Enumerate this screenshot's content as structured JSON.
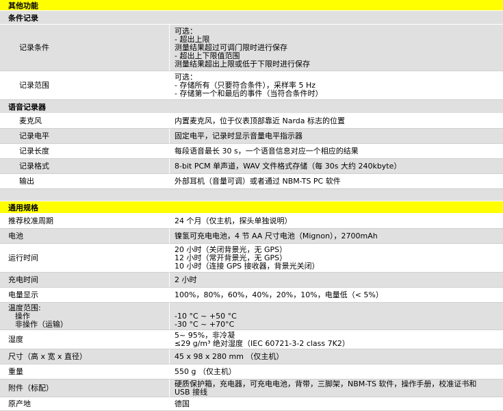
{
  "sections": {
    "other": "其他功能",
    "general": "通用规格"
  },
  "subsections": {
    "condition": "条件记录",
    "voice": "语音记录器"
  },
  "condition_rows": [
    {
      "label": "记录条件",
      "lines": [
        "可选：",
        "- 超出上限",
        "测量结果超过可调门限时进行保存",
        "- 超出上下限值范围",
        "测量结果超出上限或低于下限时进行保存"
      ]
    },
    {
      "label": "记录范围",
      "lines": [
        "可选：",
        "- 存储所有（只要符合条件），采样率 5 Hz",
        "- 存储第一个和最后的事件（当符合条件时）"
      ]
    }
  ],
  "voice_rows": [
    {
      "label": "麦克风",
      "lines": [
        "内置麦克风，位于仪表顶部靠近 Narda 标志的位置"
      ]
    },
    {
      "label": "记录电平",
      "lines": [
        "固定电平，记录时显示音量电平指示器"
      ]
    },
    {
      "label": "记录长度",
      "lines": [
        "每段语音最长 30 s，一个语音信息对应一个相应的结果"
      ]
    },
    {
      "label": "记录格式",
      "lines": [
        "8-bit PCM 单声道，WAV 文件格式存储（每 30s 大约 240kbyte）"
      ]
    },
    {
      "label": "输出",
      "lines": [
        "外部耳机（音量可调）或者通过 NBM-TS PC 软件"
      ]
    }
  ],
  "general_rows": [
    {
      "label": "推荐校准周期",
      "lines": [
        "24 个月（仅主机，探头单独说明）"
      ]
    },
    {
      "label": "电池",
      "lines": [
        "镍氢可充电电池，4 节 AA 尺寸电池（Mignon），2700mAh"
      ]
    },
    {
      "label": "运行时间",
      "lines": [
        "20 小时（关闭背景光，无 GPS）",
        "12 小时（常开背景光，无 GPS）",
        "10 小时（连接 GPS 接收器，背景光关闭）"
      ]
    },
    {
      "label": "充电时间",
      "lines": [
        "2 小时"
      ]
    },
    {
      "label": "电量显示",
      "lines": [
        "100%，80%，60%，40%，20%，10%，电量低（< 5%）"
      ]
    },
    {
      "label": "温度范围:",
      "sublabels": [
        "操作",
        "非操作（运输）"
      ],
      "lines": [
        "",
        "-10 °C ~ +50 °C",
        "-30 °C ~ +70°C"
      ]
    },
    {
      "label": "湿度",
      "lines": [
        "5~ 95%，非冷凝",
        "≤29 g/m³ 绝对湿度（IEC 60721-3-2 class 7K2）"
      ]
    },
    {
      "label": "尺寸（高 x 宽 x 直径）",
      "lines": [
        "45 x 98 x 280 mm （仅主机）"
      ]
    },
    {
      "label": "重量",
      "lines": [
        "550 g （仅主机）"
      ]
    },
    {
      "label": "附件（标配）",
      "lines": [
        "硬质保护箱，充电器，可充电电池，背带，三脚架，NBM-TS 软件，操作手册，校准证书和",
        "USB 接线"
      ]
    },
    {
      "label": "原产地",
      "lines": [
        "德国"
      ]
    }
  ]
}
